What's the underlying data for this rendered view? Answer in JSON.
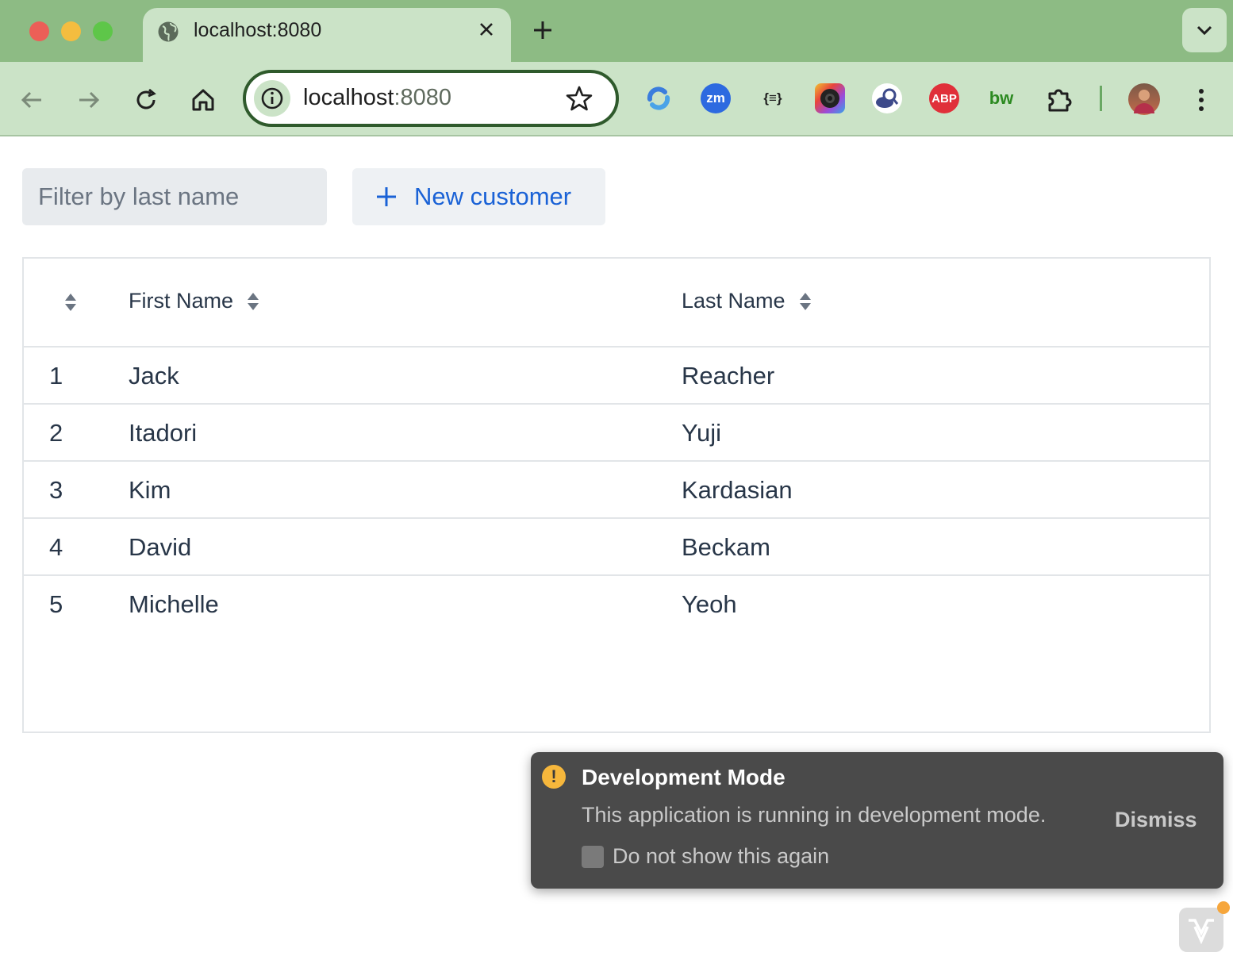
{
  "browser": {
    "tab": {
      "title": "localhost:8080"
    },
    "address": {
      "host": "localhost",
      "port": ":8080"
    },
    "extensions": [
      {
        "name": "sync-extension-icon"
      },
      {
        "name": "zoom-extension-icon",
        "text": "zm"
      },
      {
        "name": "json-extension-icon",
        "text": "{≡}"
      },
      {
        "name": "screen-recorder-extension-icon"
      },
      {
        "name": "translate-extension-icon"
      },
      {
        "name": "adblock-extension-icon",
        "text": "ABP"
      },
      {
        "name": "bitwarden-extension-icon",
        "text": "bw"
      }
    ]
  },
  "toolbar": {
    "filter_placeholder": "Filter by last name",
    "new_customer_label": "New customer"
  },
  "grid": {
    "columns": [
      "",
      "First Name",
      "Last Name"
    ],
    "rows": [
      {
        "id": "1",
        "first": "Jack",
        "last": "Reacher"
      },
      {
        "id": "2",
        "first": "Itadori",
        "last": "Yuji"
      },
      {
        "id": "3",
        "first": "Kim",
        "last": "Kardasian"
      },
      {
        "id": "4",
        "first": "David",
        "last": "Beckam"
      },
      {
        "id": "5",
        "first": "Michelle",
        "last": "Yeoh"
      }
    ]
  },
  "notification": {
    "icon": "!",
    "title": "Development Mode",
    "message": "This application is running in development mode.",
    "dismiss_label": "Dismiss",
    "checkbox_label": "Do not show this again"
  },
  "colors": {
    "tab_strip": "#8dbb84",
    "toolbar": "#cbe3c7",
    "accent_link": "#1a62d6",
    "toast_bg": "#4a4a4a",
    "warning": "#f6b73c"
  }
}
